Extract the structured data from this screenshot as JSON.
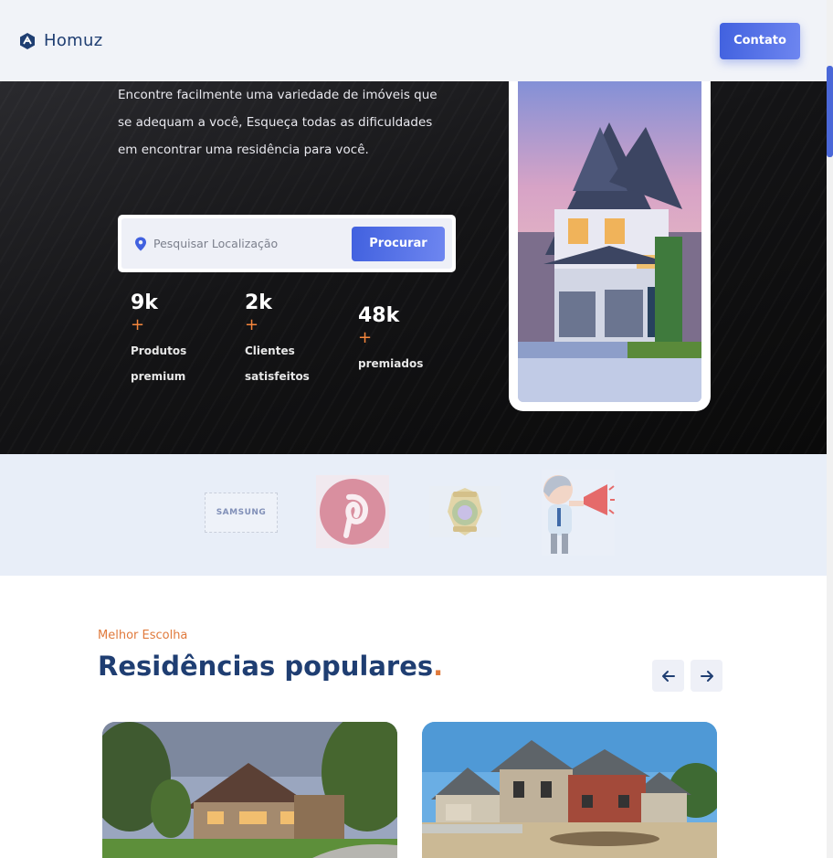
{
  "brand": {
    "name": "Homuz"
  },
  "header": {
    "contact_label": "Contato"
  },
  "hero": {
    "description": "Encontre facilmente uma variedade de imóveis que se adequam a você, Esqueça todas as dificuldades em encontrar uma residência para você.",
    "search": {
      "placeholder": "Pesquisar Localização",
      "button_label": "Procurar"
    },
    "stats": [
      {
        "value": "9k",
        "plus": "+",
        "label": "Produtos premium"
      },
      {
        "value": "2k",
        "plus": "+",
        "label": "Clientes satisfeitos"
      },
      {
        "value": "48k",
        "plus": "+",
        "label": "premiados"
      }
    ]
  },
  "companies": {
    "samsung_text": "SAMSUNG"
  },
  "popular": {
    "subtitle": "Melhor Escolha",
    "title": "Residências populares",
    "title_dot": "."
  },
  "colors": {
    "accent": "#4161df",
    "orange": "#e07a3c",
    "navy": "#1f3e72"
  },
  "icons": [
    "logo-icon",
    "location-pin-icon",
    "arrow-left-icon",
    "arrow-right-icon"
  ]
}
